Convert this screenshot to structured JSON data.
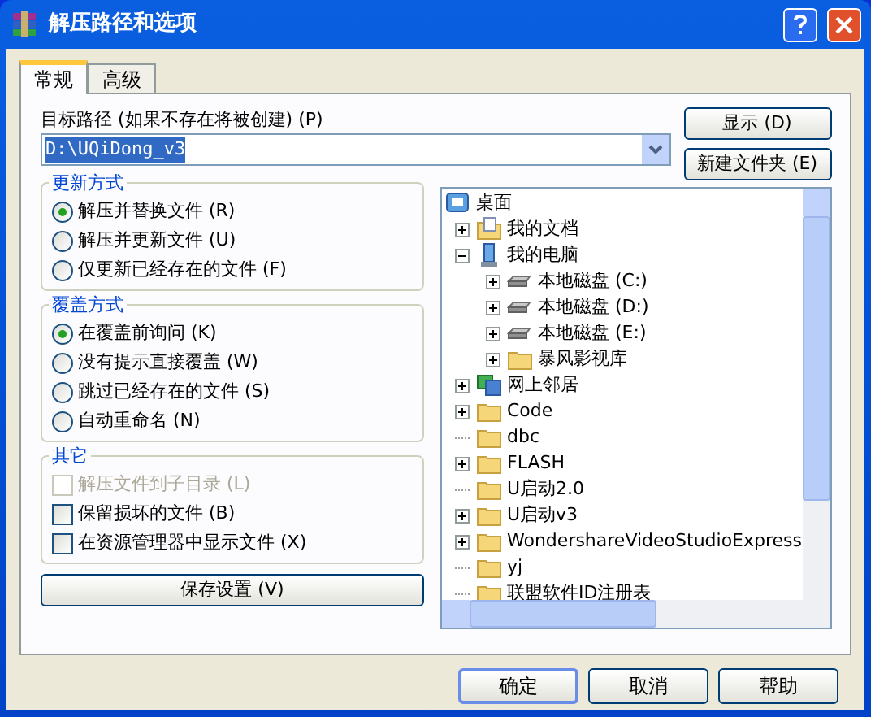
{
  "window": {
    "title": "解压路径和选项"
  },
  "tabs": [
    {
      "label": "常规",
      "selected": true
    },
    {
      "label": "高级",
      "selected": false
    }
  ],
  "path": {
    "label": "目标路径 (如果不存在将被创建) (P)",
    "value": "D:\\UQiDong_v3"
  },
  "side_buttons": [
    "显示 (D)",
    "新建文件夹 (E)"
  ],
  "groups": [
    {
      "title": "更新方式",
      "options": [
        {
          "kind": "radio",
          "label": "解压并替换文件 (R)",
          "selected": true
        },
        {
          "kind": "radio",
          "label": "解压并更新文件 (U)",
          "selected": false
        },
        {
          "kind": "radio",
          "label": "仅更新已经存在的文件 (F)",
          "selected": false
        }
      ]
    },
    {
      "title": "覆盖方式",
      "options": [
        {
          "kind": "radio",
          "label": "在覆盖前询问 (K)",
          "selected": true
        },
        {
          "kind": "radio",
          "label": "没有提示直接覆盖 (W)",
          "selected": false
        },
        {
          "kind": "radio",
          "label": "跳过已经存在的文件 (S)",
          "selected": false
        },
        {
          "kind": "radio",
          "label": "自动重命名 (N)",
          "selected": false
        }
      ]
    },
    {
      "title": "其它",
      "options": [
        {
          "kind": "checkbox",
          "label": "解压文件到子目录 (L)",
          "checked": false,
          "disabled": true
        },
        {
          "kind": "checkbox",
          "label": "保留损坏的文件 (B)",
          "checked": false,
          "disabled": false
        },
        {
          "kind": "checkbox",
          "label": "在资源管理器中显示文件 (X)",
          "checked": false,
          "disabled": false
        }
      ]
    }
  ],
  "save_button": "保存设置 (V)",
  "tree": [
    {
      "kind": "desktop",
      "label": "桌面",
      "children": [
        {
          "kind": "documents",
          "label": "我的文档",
          "expanded": false
        },
        {
          "kind": "computer",
          "label": "我的电脑",
          "expanded": true,
          "children": [
            {
              "kind": "drive",
              "label": "本地磁盘 (C:)",
              "expanded": false
            },
            {
              "kind": "drive",
              "label": "本地磁盘 (D:)",
              "expanded": false
            },
            {
              "kind": "drive",
              "label": "本地磁盘 (E:)",
              "expanded": false
            },
            {
              "kind": "folder",
              "label": "暴风影视库",
              "expanded": false
            }
          ]
        },
        {
          "kind": "network",
          "label": "网上邻居",
          "expanded": false
        },
        {
          "kind": "folder",
          "label": "Code",
          "expanded": false
        },
        {
          "kind": "folder",
          "label": "dbc"
        },
        {
          "kind": "folder",
          "label": "FLASH",
          "expanded": false
        },
        {
          "kind": "folder",
          "label": "U启动2.0"
        },
        {
          "kind": "folder",
          "label": "U启动v3",
          "expanded": false
        },
        {
          "kind": "folder",
          "label": "WondershareVideoStudioExpress",
          "expanded": false
        },
        {
          "kind": "folder",
          "label": "yj"
        },
        {
          "kind": "folder",
          "label": "联盟软件ID注册表"
        }
      ]
    }
  ],
  "buttons": [
    "确定",
    "取消",
    "帮助"
  ]
}
